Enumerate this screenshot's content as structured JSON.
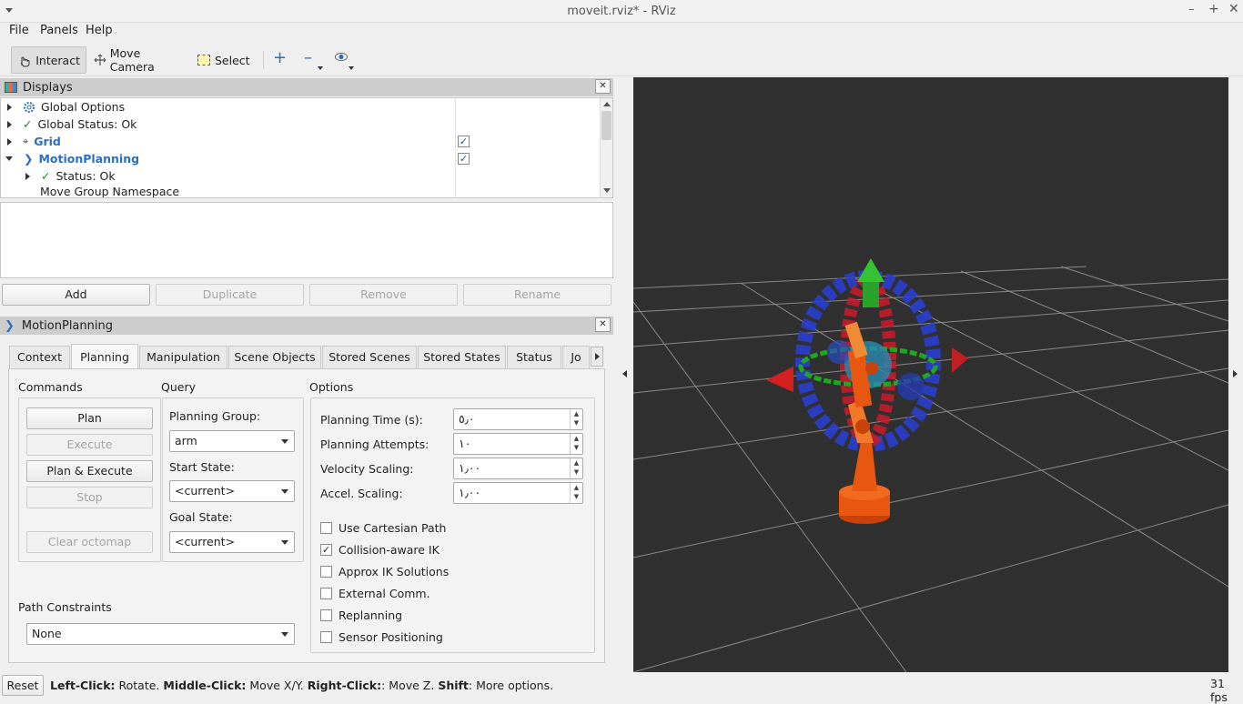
{
  "window": {
    "title": "moveit.rviz* - RViz"
  },
  "menu": [
    "File",
    "Panels",
    "Help"
  ],
  "toolbar": {
    "interact": "Interact",
    "move_camera": "Move Camera",
    "select": "Select"
  },
  "displays": {
    "title": "Displays",
    "rows": [
      {
        "label": "Global Options"
      },
      {
        "label": "Global Status: Ok"
      },
      {
        "label": "Grid",
        "checked": true
      },
      {
        "label": "MotionPlanning",
        "checked": true
      },
      {
        "label": "Status: Ok"
      },
      {
        "label": "Move Group Namespace"
      }
    ],
    "buttons": {
      "add": "Add",
      "duplicate": "Duplicate",
      "remove": "Remove",
      "rename": "Rename"
    }
  },
  "motion_planning": {
    "title": "MotionPlanning",
    "tabs": [
      "Context",
      "Planning",
      "Manipulation",
      "Scene Objects",
      "Stored Scenes",
      "Stored States",
      "Status",
      "Jo"
    ],
    "selected_tab": "Planning",
    "commands": {
      "heading": "Commands",
      "plan": "Plan",
      "execute": "Execute",
      "plan_execute": "Plan & Execute",
      "stop": "Stop",
      "clear_octomap": "Clear octomap"
    },
    "query": {
      "heading": "Query",
      "planning_group_label": "Planning Group:",
      "planning_group": "arm",
      "start_state_label": "Start State:",
      "start_state": "<current>",
      "goal_state_label": "Goal State:",
      "goal_state": "<current>"
    },
    "options": {
      "heading": "Options",
      "planning_time_label": "Planning Time (s):",
      "planning_time": "٥٫٠",
      "planning_attempts_label": "Planning Attempts:",
      "planning_attempts": "١٠",
      "velocity_label": "Velocity Scaling:",
      "velocity": "١٫٠٠",
      "accel_label": "Accel. Scaling:",
      "accel": "١٫٠٠",
      "checks": [
        {
          "label": "Use Cartesian Path",
          "checked": false
        },
        {
          "label": "Collision-aware IK",
          "checked": true
        },
        {
          "label": "Approx IK Solutions",
          "checked": false
        },
        {
          "label": "External Comm.",
          "checked": false
        },
        {
          "label": "Replanning",
          "checked": false
        },
        {
          "label": "Sensor Positioning",
          "checked": false
        }
      ]
    },
    "path_constraints": {
      "heading": "Path Constraints",
      "value": "None"
    }
  },
  "status": {
    "reset": "Reset",
    "left_key": "Left-Click:",
    "left_desc": " Rotate. ",
    "middle_key": "Middle-Click:",
    "middle_desc": " Move X/Y. ",
    "right_key": "Right-Click:",
    "right_desc": ": Move Z. ",
    "shift_key": "Shift",
    "shift_desc": ": More options.",
    "fps": "31 fps"
  },
  "colors": {
    "link": "#2a6fc0",
    "viewport_bg": "#303030",
    "robot": "#e8570f"
  }
}
